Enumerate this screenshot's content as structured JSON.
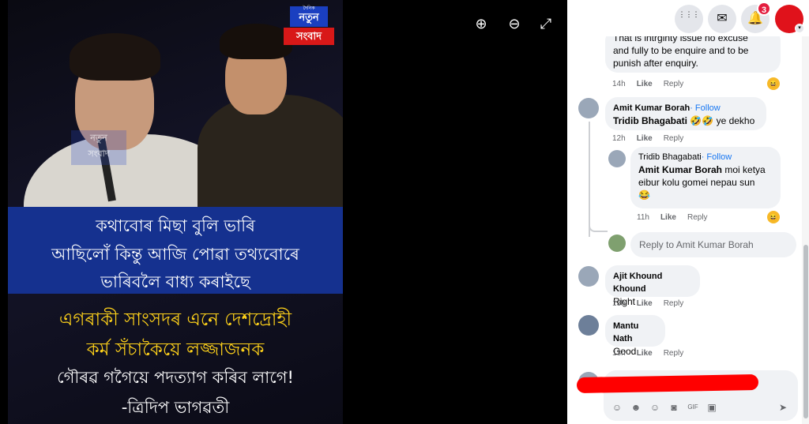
{
  "post_image": {
    "logo_top": "নতুন",
    "logo_tiny": "দৈনিক",
    "logo_bottom": "সংবাদ",
    "watermark_top": "নতুন",
    "watermark_bottom": "সংবাদ",
    "band_lines": [
      "কথাবোৰ মিছা বুলি ভাৰি",
      "আছিলোঁ কিন্তু আজি পোৱা তথ্যবোৰে",
      "ভাৰিবলৈ বাধ্য কৰাইছে"
    ],
    "yellow_lines": [
      "এগৰাকী সাংসদৰ এনে দেশদ্ৰোহী",
      "কৰ্ম সঁচাকৈয়ে লজ্জাজনক"
    ],
    "white_lines": [
      "গৌৰৱ গগৈয়ে পদত্যাগ কৰিব লাগে!",
      "-ত্ৰিদিপ ভাগৱতী"
    ]
  },
  "viewer_controls": {
    "zoom_in_icon": "⊕",
    "zoom_out_icon": "⊖",
    "fullscreen_icon": "⤢"
  },
  "topbar": {
    "menu_icon": "⋮⋮⋮",
    "messenger_icon": "✉",
    "notifications_icon": "🔔",
    "notification_count": "3"
  },
  "comments": [
    {
      "text_lines": [
        "That is intrginty issue no excuse",
        "and fully to be enquire and to be",
        "punish after enquiry."
      ],
      "time": "14h",
      "like": "Like",
      "reply": "Reply"
    },
    {
      "author": "Amit Kumar Borah",
      "follow": "· Follow",
      "mention": "Tridib Bhagabati",
      "text": " 🤣🤣 ye dekho",
      "time": "12h",
      "like": "Like",
      "reply": "Reply"
    },
    {
      "author": "Tridib Bhagabati",
      "follow": "· Follow",
      "mention": "Amit Kumar Borah",
      "text": " moi ketya eibur kolu gomei nepau sun",
      "text_tail": "😂",
      "time": "11h",
      "like": "Like",
      "reply": "Reply"
    },
    {
      "author": "Ajit Khound Khound",
      "text": "Right",
      "time": "13h",
      "like": "Like",
      "reply": "Reply"
    },
    {
      "author": "Mantu Nath",
      "text": "Good",
      "time": "13h",
      "like": "Like",
      "reply": "Reply"
    }
  ],
  "reply_placeholder": "Reply to Amit Kumar Borah",
  "colors": {
    "accent": "#1877f2",
    "badge": "#e41e3f",
    "redaction": "#ff0000",
    "band": "#15318f",
    "headline_yellow": "#ffd21a"
  }
}
